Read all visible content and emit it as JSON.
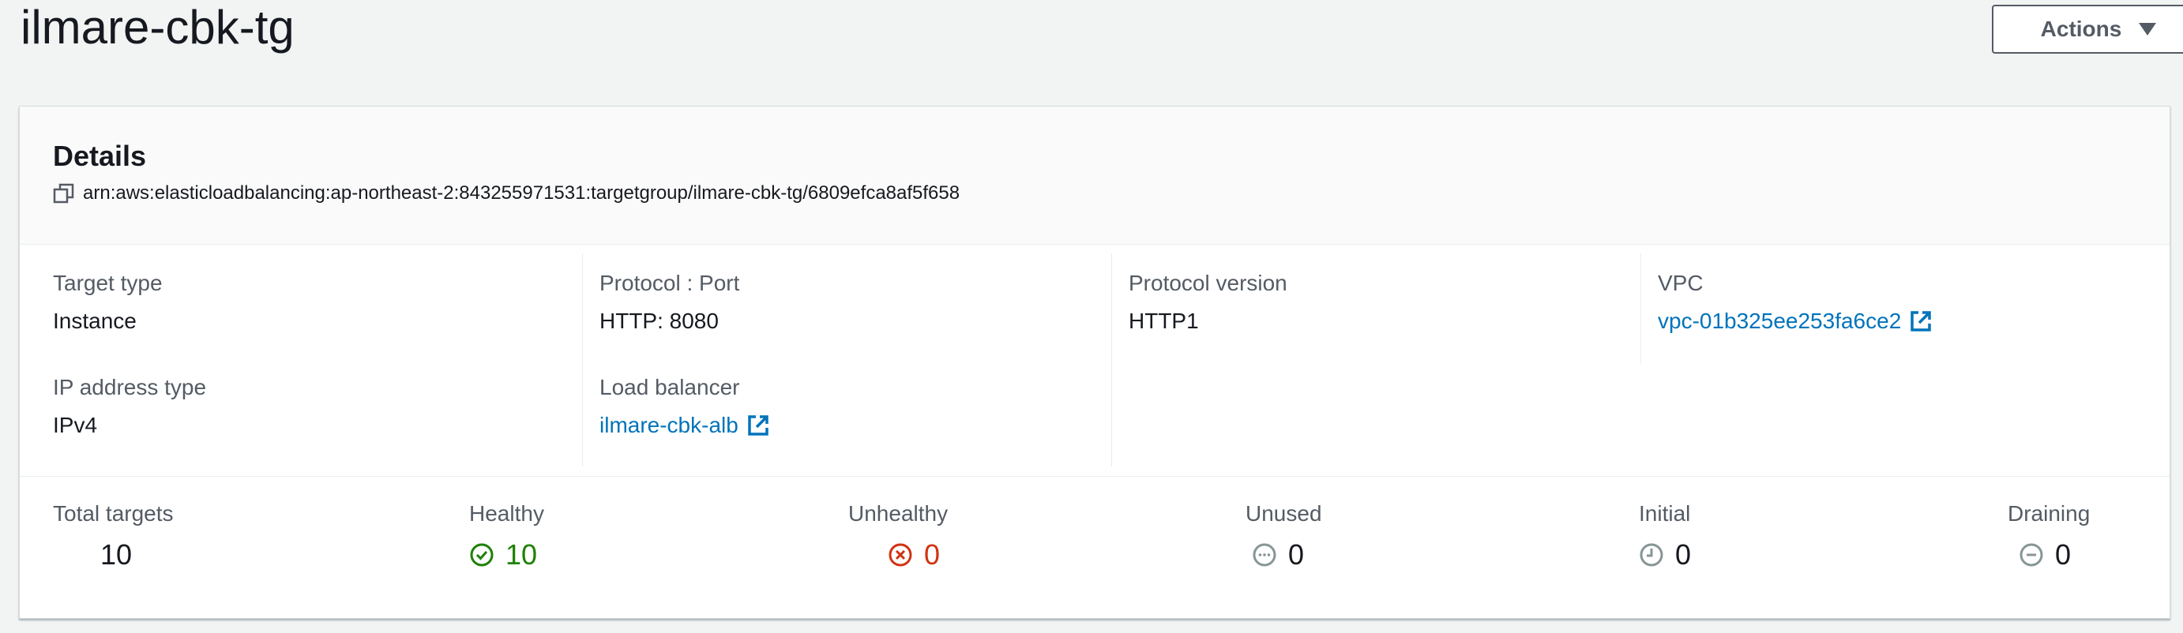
{
  "header": {
    "title": "ilmare-cbk-tg",
    "actions_label": "Actions"
  },
  "details": {
    "title": "Details",
    "arn": "arn:aws:elasticloadbalancing:ap-northeast-2:843255971531:targetgroup/ilmare-cbk-tg/6809efca8af5f658",
    "target_type": {
      "label": "Target type",
      "value": "Instance"
    },
    "ip_address_type": {
      "label": "IP address type",
      "value": "IPv4"
    },
    "protocol_port": {
      "label": "Protocol : Port",
      "value": "HTTP: 8080"
    },
    "load_balancer": {
      "label": "Load balancer",
      "value": "ilmare-cbk-alb"
    },
    "protocol_version": {
      "label": "Protocol version",
      "value": "HTTP1"
    },
    "vpc": {
      "label": "VPC",
      "value": "vpc-01b325ee253fa6ce2"
    }
  },
  "counts": {
    "total": {
      "label": "Total targets",
      "value": "10"
    },
    "healthy": {
      "label": "Healthy",
      "value": "10",
      "icon": "check-circle-icon",
      "color": "#1d8102"
    },
    "unhealthy": {
      "label": "Unhealthy",
      "value": "0",
      "icon": "x-circle-icon",
      "color": "#d13212"
    },
    "unused": {
      "label": "Unused",
      "value": "0",
      "icon": "ellipsis-circle-icon",
      "color": "#879596"
    },
    "initial": {
      "label": "Initial",
      "value": "0",
      "icon": "clock-icon",
      "color": "#879596"
    },
    "draining": {
      "label": "Draining",
      "value": "0",
      "icon": "minus-circle-icon",
      "color": "#879596"
    }
  },
  "colors": {
    "link": "#0073bb",
    "text": "#16191f",
    "label": "#545b64",
    "background": "#f2f3f3"
  }
}
